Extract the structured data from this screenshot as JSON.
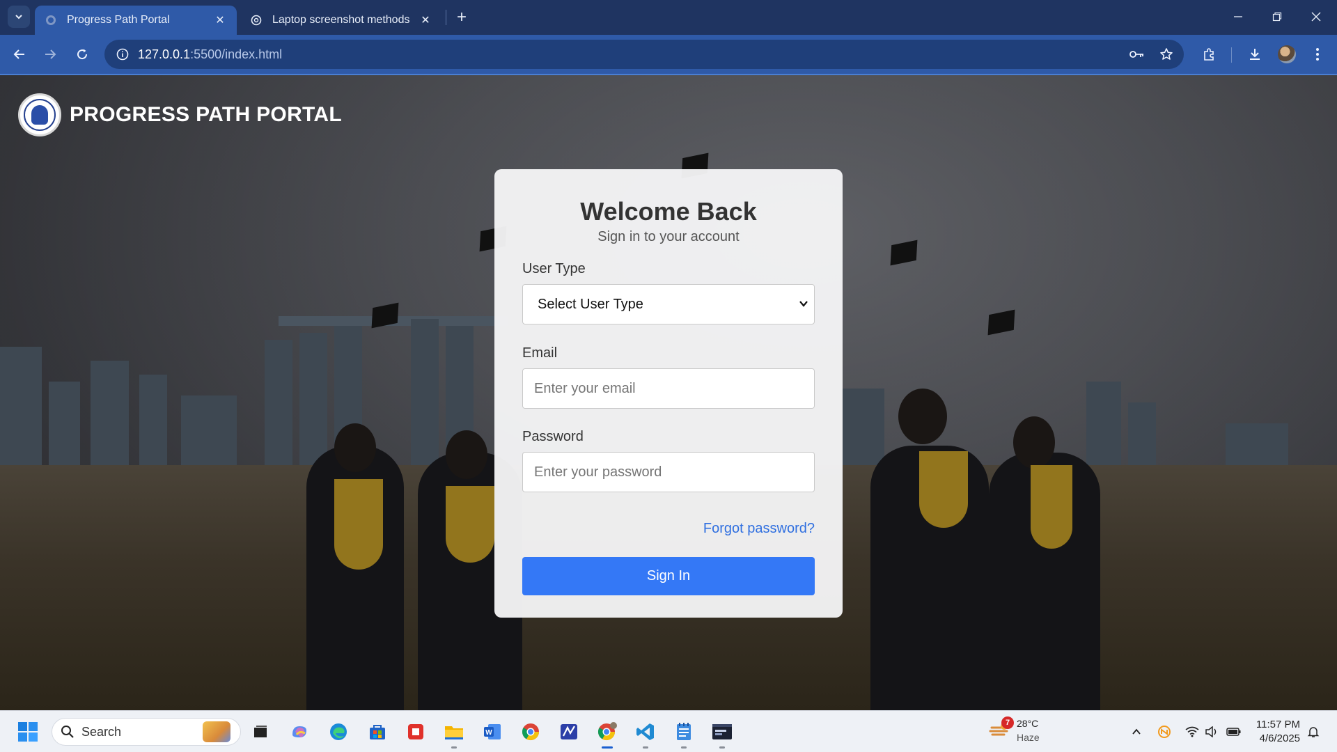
{
  "browser": {
    "tabs": [
      {
        "title": "Progress Path Portal",
        "active": true
      },
      {
        "title": "Laptop screenshot methods",
        "active": false
      }
    ],
    "url_host": "127.0.0.1",
    "url_path": ":5500/index.html"
  },
  "header": {
    "portal_title": "PROGRESS PATH PORTAL"
  },
  "login": {
    "heading": "Welcome Back",
    "subheading": "Sign in to your account",
    "user_type_label": "User Type",
    "user_type_selected": "Select User Type",
    "email_label": "Email",
    "email_placeholder": "Enter your email",
    "password_label": "Password",
    "password_placeholder": "Enter your password",
    "forgot_link": "Forgot password?",
    "signin_button": "Sign In",
    "accent_color": "#3478f6"
  },
  "taskbar": {
    "search_placeholder": "Search",
    "weather_temp": "28°C",
    "weather_desc": "Haze",
    "weather_badge": "7",
    "time": "11:57 PM",
    "date": "4/6/2025",
    "pinned_icons": [
      "start-icon",
      "task-view-icon",
      "copilot-icon",
      "edge-icon",
      "store-icon",
      "media-icon",
      "file-explorer-icon",
      "word-icon",
      "chrome-icon",
      "math-icon",
      "chrome-profile-icon",
      "vscode-icon",
      "notepad-icon",
      "terminal-icon"
    ]
  }
}
